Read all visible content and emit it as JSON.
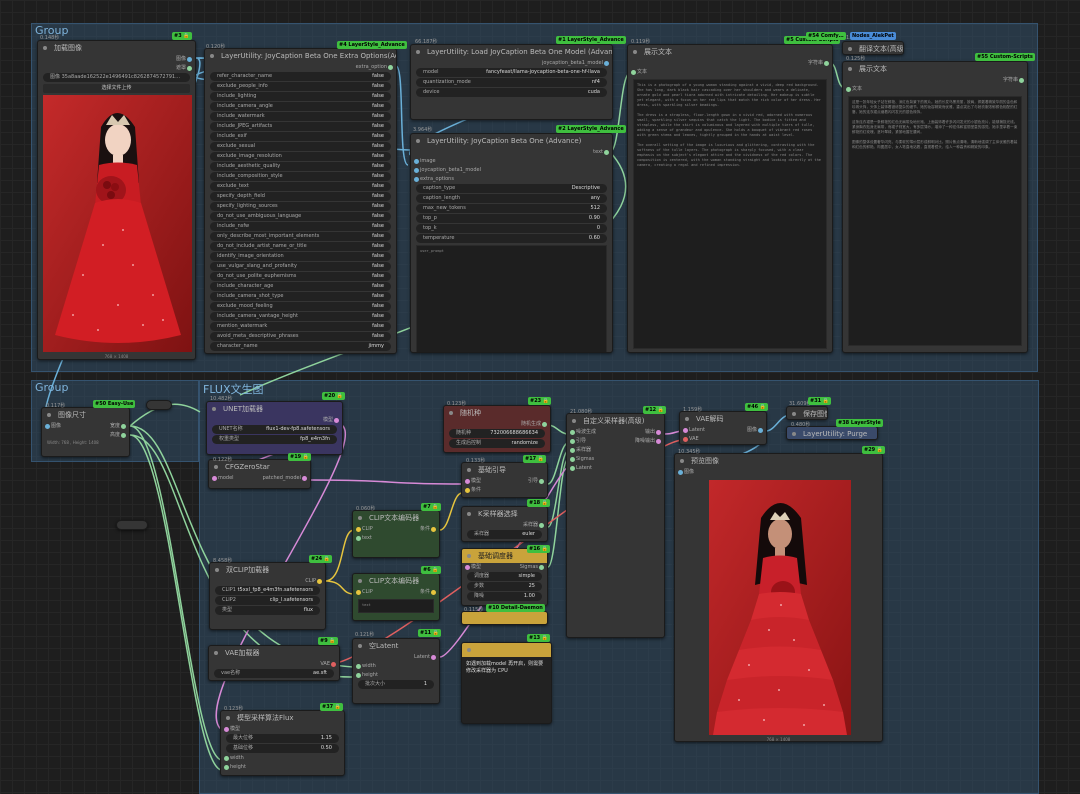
{
  "groups": {
    "top_title": "Group",
    "mid_title": "Group",
    "flux_title": "FLUX文生图"
  },
  "colors": {
    "group_fill": "#324e68",
    "header_green": "#3fbf3f",
    "clip_node": "#2f4a2f",
    "seed_node": "#5a2b2b",
    "note_node": "#c9a33b",
    "unet_node": "#3a3560",
    "wire_blue": "#6ab0d8",
    "wire_yellow": "#e7c53e",
    "wire_pink": "#d78ad7",
    "wire_green": "#8fd39c"
  },
  "load_image": {
    "time": "0.148秒",
    "badge": "#3 🔒",
    "title": "加载图像",
    "out_image": "图像",
    "out_mask": "遮罩",
    "file_value": "图像 35a8aade162522e1496491c8262874572791…",
    "upload_label": "选择文件上传",
    "dims": "768 × 1408"
  },
  "extra_opts": {
    "time": "0.120秒",
    "badge": "#4 LayerStyle_Advance",
    "title": "LayerUtility: JoyCaption Beta One Extra Options(Advance)",
    "out": "extra_option",
    "options": [
      {
        "k": "refer_character_name",
        "v": "false"
      },
      {
        "k": "exclude_people_info",
        "v": "false"
      },
      {
        "k": "include_lighting",
        "v": "false"
      },
      {
        "k": "include_camera_angle",
        "v": "false"
      },
      {
        "k": "include_watermark",
        "v": "false"
      },
      {
        "k": "include_JPEG_artifacts",
        "v": "false"
      },
      {
        "k": "include_exif",
        "v": "false"
      },
      {
        "k": "exclude_sexual",
        "v": "false"
      },
      {
        "k": "exclude_image_resolution",
        "v": "false"
      },
      {
        "k": "include_aesthetic_quality",
        "v": "false"
      },
      {
        "k": "include_composition_style",
        "v": "false"
      },
      {
        "k": "exclude_text",
        "v": "false"
      },
      {
        "k": "specify_depth_field",
        "v": "false"
      },
      {
        "k": "specify_lighting_sources",
        "v": "false"
      },
      {
        "k": "do_not_use_ambiguous_language",
        "v": "false"
      },
      {
        "k": "include_nsfw",
        "v": "false"
      },
      {
        "k": "only_describe_most_important_elements",
        "v": "false"
      },
      {
        "k": "do_not_include_artist_name_or_title",
        "v": "false"
      },
      {
        "k": "identify_image_orientation",
        "v": "false"
      },
      {
        "k": "use_vulgar_slang_and_profanity",
        "v": "false"
      },
      {
        "k": "do_not_use_polite_euphemisms",
        "v": "false"
      },
      {
        "k": "include_character_age",
        "v": "false"
      },
      {
        "k": "include_camera_shot_type",
        "v": "false"
      },
      {
        "k": "exclude_mood_feeling",
        "v": "false"
      },
      {
        "k": "include_camera_vantage_height",
        "v": "false"
      },
      {
        "k": "mention_watermark",
        "v": "false"
      },
      {
        "k": "avoid_meta_descriptive_phrases",
        "v": "false"
      },
      {
        "k": "character_name",
        "v": "jimmy"
      }
    ]
  },
  "load_model": {
    "time": "66.187秒",
    "badge": "#1 LayerStyle_Advance",
    "title": "LayerUtility: Load JoyCaption Beta One Model (Advance)",
    "out": "joycaption_beta1_model",
    "rows": [
      {
        "k": "model",
        "v": "fancyfeast/llama-joycaption-beta-one-hf-llava"
      },
      {
        "k": "quantization_mode",
        "v": "nf4"
      },
      {
        "k": "device",
        "v": "cuda"
      }
    ]
  },
  "joycaption": {
    "time": "3.964秒",
    "badge": "#2 LayerStyle_Advance",
    "title": "LayerUtility: JoyCaption Beta One (Advance)",
    "out": "text",
    "inputs": [
      "image",
      "joycaption_beta1_model",
      "extra_options"
    ],
    "rows": [
      {
        "k": "caption_type",
        "v": "Descriptive"
      },
      {
        "k": "caption_length",
        "v": "any"
      },
      {
        "k": "max_new_tokens",
        "v": "512"
      },
      {
        "k": "top_p",
        "v": "0.90"
      },
      {
        "k": "top_k",
        "v": "0"
      },
      {
        "k": "temperature",
        "v": "0.60"
      }
    ],
    "prompt_placeholder": "user_prompt"
  },
  "show_text": {
    "time": "0.119秒",
    "badge": "#5 Custom-Scripts",
    "title": "展示文本",
    "in": "文本",
    "out": "字符串",
    "body": "This is a photograph of a young woman standing against a vivid, deep red background. She has long, dark black hair cascading over her shoulders and wears a delicate, ornate gold and pearl tiara adorned with intricate detailing. Her makeup is subtle yet elegant, with a focus on her red lips that match the rich color of her dress. Her dress, with sparkling silver beadings.\n\nThe dress is a strapless, floor-length gown in a vivid red, adorned with numerous small, sparkling silver sequins that catch the light. The bodice is fitted and strapless, while the skirt is voluminous and layered with multiple tiers of tulle, adding a sense of grandeur and opulence. She holds a bouquet of vibrant red roses with green stems and leaves, tightly grouped in the hands at waist level.\n\nThe overall setting of the image is luxurious and glittering, contrasting with the softness of the tulle layers. The photograph is sharply focused, with a clear emphasis on the subject's elegant attire and the vividness of the red colors. The composition is centered, with the woman standing straight and looking directly at the camera, creating a regal and refined impression."
  },
  "translate": {
    "time": "1.169秒",
    "badge": "#54 Comfy…",
    "title": "翻译文本(高级)",
    "badge2": "Nodes_AlekPet"
  },
  "show_text2": {
    "time": "0.125秒",
    "badge": "#55 Custom-Scripts",
    "title": "展示文本",
    "in": "文本",
    "out": "字符串",
    "body": "这是一张年轻女子站在鲜艳、深红色背景下的照片。她的长发乌黑亮丽，披肩，佩戴着精致华丽的金色和珍珠头饰，头饰上装饰着错综复杂的细节。她的妆容精致而优雅，重点突出了与她衣服浓郁颜色相配的红唇，她的连衣裙点缀着闪闪发光的银色珠饰。\n\n这条连衣裙是一条鲜艳的红色无肩带及地长袍，上面装饰着许多闪闪发光的小银色亮片，能够捕捉光线。紧身胸衣贴身无肩带，而裙子则宽大，有多层薄纱，增添了一种宏伟和富丽堂皇的感觉。她手里拿着一束鲜艳的红玫瑰，茎叶翠绿，紧紧地握在腰间。\n\n图像的整体设置奢华闪亮，与柔软的薄纱层形成鲜明对比。照片焦点清晰，清晰地强调了主体优雅的着装和红色的鲜艳。构图居中，女人笔直地站着，直视着镜头，给人一种高贵和精致的印象。"
  },
  "image_size": {
    "time": "0.117秒",
    "badge": "#50 Easy-Use",
    "title": "图像尺寸",
    "in": "图像",
    "out_w": "宽度",
    "out_h": "高度",
    "info": "Width: 768 , Height: 1408"
  },
  "unet": {
    "time": "10.482秒",
    "badge": "#20 🔒",
    "title": "UNET加载器",
    "out": "模型",
    "rows": [
      {
        "k": "UNET名称",
        "v": "flux1-dev-fp8.safetensors"
      },
      {
        "k": "权重类型",
        "v": "fp8_e4m3fn"
      }
    ]
  },
  "cfgzero": {
    "time": "0.122秒",
    "badge": "#19 🔒",
    "title": "CFGZeroStar",
    "in": "model",
    "out": "patched_model"
  },
  "dual_clip": {
    "time": "8.458秒",
    "badge": "#24 🔒",
    "title": "双CLIP加载器",
    "out": "CLIP",
    "rows": [
      {
        "k": "CLIP1",
        "v": "t5xxl_fp8_e4m3fn.safetensors"
      },
      {
        "k": "CLIP2",
        "v": "clip_l.safetensors"
      },
      {
        "k": "类型",
        "v": "flux"
      }
    ]
  },
  "vae_loader": {
    "badge": "#9 🔒",
    "title": "VAE加载器",
    "out": "VAE",
    "rows": [
      {
        "k": "vae名称",
        "v": "ae.sft"
      }
    ]
  },
  "model_sampling": {
    "time": "0.123秒",
    "badge": "#37 🔒",
    "title": "模型采样算法Flux",
    "in": "模型",
    "rows": [
      {
        "k": "最大位移",
        "v": "1.15"
      },
      {
        "k": "基础位移",
        "v": "0.50"
      }
    ],
    "in_w": "width",
    "in_h": "height"
  },
  "clip_enc1": {
    "time": "0.060秒",
    "badge": "#7 🔒",
    "title": "CLIP文本编码器",
    "in": "CLIP",
    "in2": "text",
    "out": "条件"
  },
  "clip_enc2": {
    "badge": "#6 🔒",
    "title": "CLIP文本编码器",
    "in": "CLIP",
    "out": "条件",
    "body": "text"
  },
  "seed": {
    "time": "0.123秒",
    "badge": "#23 🔒",
    "title": "随机种",
    "out": "随机生成",
    "rows": [
      {
        "k": "随机种",
        "v": "732006688686634"
      },
      {
        "k": "生成后控制",
        "v": "randomize"
      }
    ]
  },
  "basic_guider": {
    "time": "0.133秒",
    "badge": "#17 🔒",
    "title": "基础引导",
    "in1": "模型",
    "in2": "条件",
    "out": "引导"
  },
  "ksampler_select": {
    "badge": "#18 🔒",
    "title": "K采样器选择",
    "out": "采样器",
    "rows": [
      {
        "k": "采样器",
        "v": "euler"
      }
    ]
  },
  "scheduler": {
    "badge": "#16 🔒",
    "title": "基础调度器",
    "in": "模型",
    "out": "Sigmas",
    "rows": [
      {
        "k": "调度器",
        "v": "simple"
      },
      {
        "k": "步数",
        "v": "25"
      },
      {
        "k": "降噪",
        "v": "1.00"
      }
    ]
  },
  "detail_daemon": {
    "time": "0.115秒",
    "badge": "#10 Detail-Daemon"
  },
  "custom_sampler": {
    "time": "21.080秒",
    "badge": "#12 🔒",
    "title": "自定义采样器(高级)",
    "ins": [
      "噪波生成",
      "引导",
      "采样器",
      "Sigmas",
      "Latent"
    ],
    "out1": "输出",
    "out2": "降噪输出"
  },
  "empty_latent": {
    "time": "0.121秒",
    "badge": "#11 🔒",
    "title": "空Latent",
    "in1": "width",
    "in2": "height",
    "out": "Latent",
    "rows": [
      {
        "k": "批次大小",
        "v": "1"
      }
    ]
  },
  "note": {
    "badge": "#13 🔒",
    "title": "",
    "body": "如遇到加载model 再开启，则需要修改采样器为 CPU"
  },
  "vae_decode": {
    "time": "1.159秒",
    "badge": "#46 🔒",
    "title": "VAE解码",
    "in1": "Latent",
    "in2": "VAE",
    "out": "图像"
  },
  "save_image": {
    "time": "31.609秒",
    "badge": "#31 🔒",
    "title": "保存图像"
  },
  "purge": {
    "time": "0.480秒",
    "badge": "#38 LayerStyle",
    "title": "LayerUtility: Purge"
  },
  "preview": {
    "time": "10.345秒",
    "badge": "#29 🔒",
    "title": "预览图像",
    "in": "图像",
    "dims": "768 × 1408"
  }
}
